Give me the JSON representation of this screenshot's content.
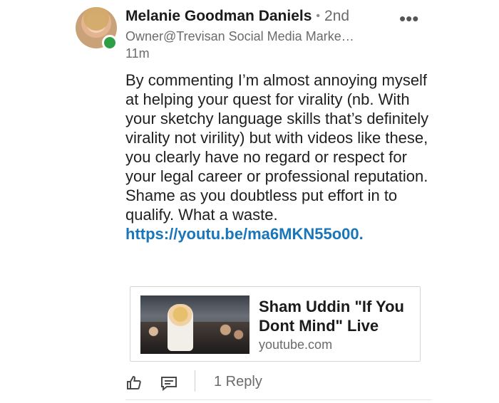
{
  "comment": {
    "author": {
      "name": "Melanie Goodman Daniels",
      "degree": "2nd",
      "headline": "Owner@Trevisan Social Media Marke…",
      "presence_color": "#2e9f44"
    },
    "time": "11m",
    "more_menu": "•••",
    "text": "By commenting I’m almost annoying myself at helping your quest for virality (nb. With your sketchy language skills that’s definitely virality not virility) but with videos like these, you clearly have no regard or respect for your legal career or professional reputation. Shame as you doubtless put effort in to qualify. What a waste.",
    "link": "https://youtu.be/ma6MKN55o00.",
    "link_color": "#1976b8",
    "preview": {
      "title": "Sham Uddin \"If You Dont Mind\" Live",
      "domain": "youtube.com"
    },
    "actions": {
      "like_icon": "like-icon",
      "comment_icon": "comment-icon",
      "reply_label": "1 Reply"
    }
  }
}
